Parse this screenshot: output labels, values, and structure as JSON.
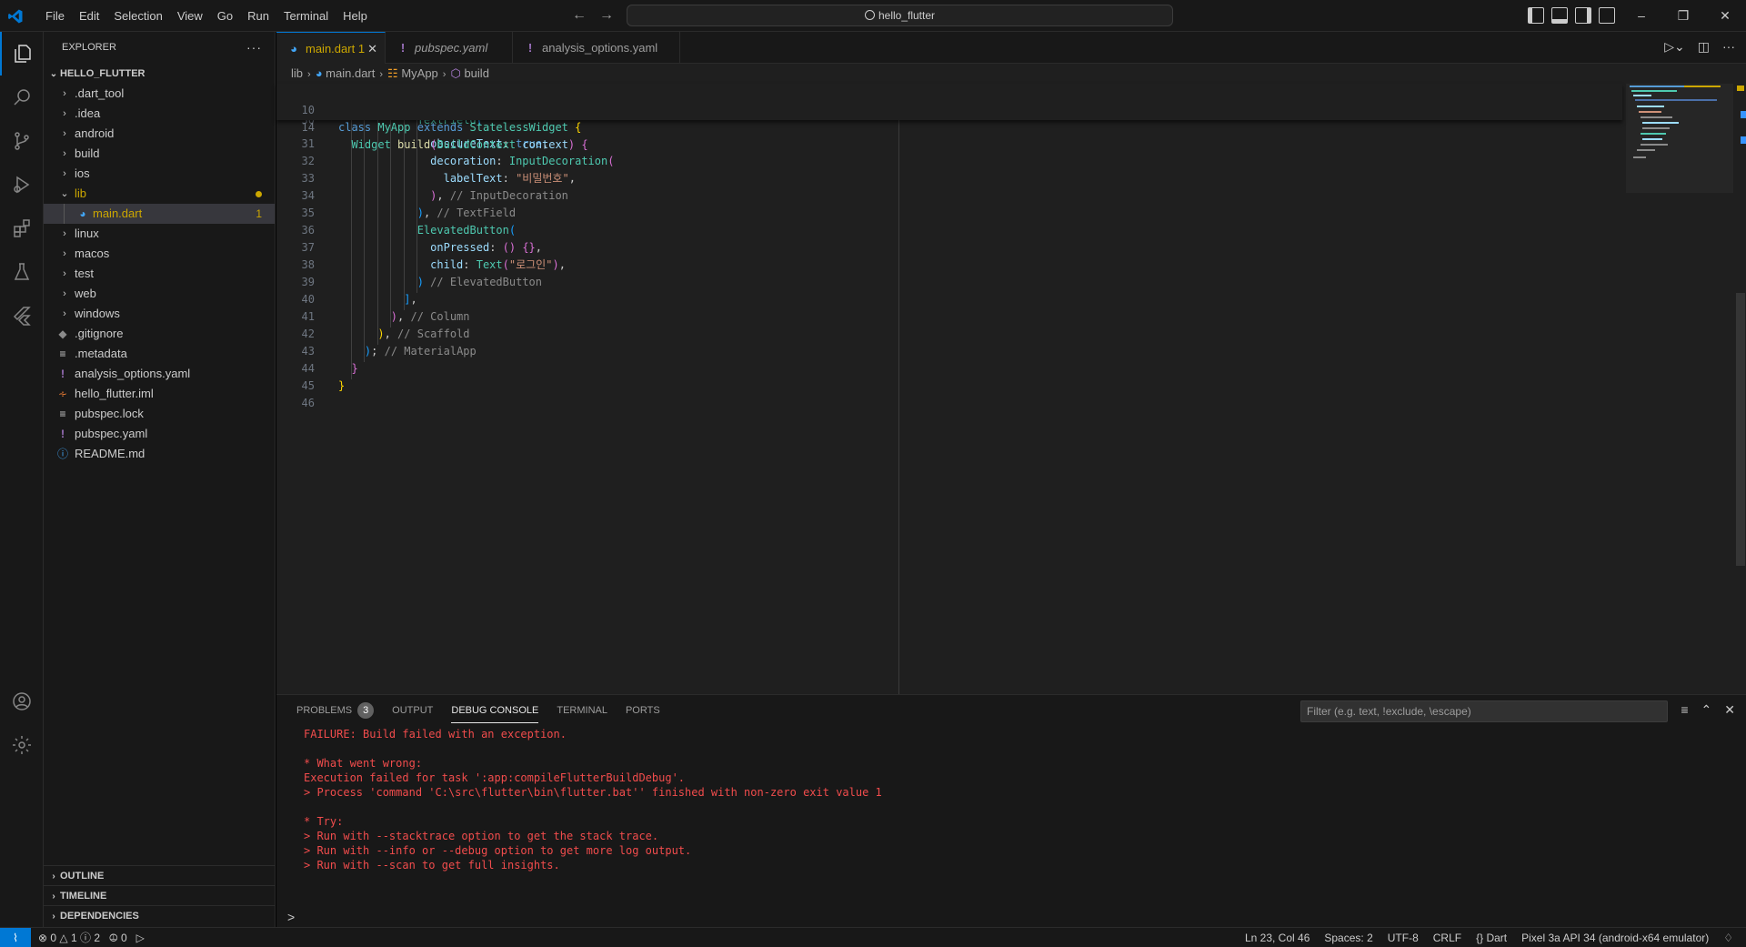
{
  "titlebar": {
    "menu": [
      "File",
      "Edit",
      "Selection",
      "View",
      "Go",
      "Run",
      "Terminal",
      "Help"
    ],
    "search": "hello_flutter"
  },
  "sidebar": {
    "header": "EXPLORER",
    "more": "···",
    "project": "HELLO_FLUTTER",
    "items": [
      {
        "label": "dart_tool",
        "prefix": "."
      },
      {
        "label": "idea",
        "prefix": "."
      },
      {
        "label": "android",
        "prefix": ""
      },
      {
        "label": "build",
        "prefix": ""
      },
      {
        "label": "ios",
        "prefix": ""
      },
      {
        "label": "lib",
        "prefix": ""
      },
      {
        "label": "main.dart",
        "prefix": ""
      },
      {
        "label": "linux",
        "prefix": ""
      },
      {
        "label": "macos",
        "prefix": ""
      },
      {
        "label": "test",
        "prefix": ""
      },
      {
        "label": "web",
        "prefix": ""
      },
      {
        "label": "windows",
        "prefix": ""
      },
      {
        "label": ".gitignore",
        "prefix": ""
      },
      {
        "label": ".metadata",
        "prefix": ""
      },
      {
        "label": "analysis_options.yaml",
        "prefix": ""
      },
      {
        "label": "hello_flutter.iml",
        "prefix": ""
      },
      {
        "label": "pubspec.lock",
        "prefix": ""
      },
      {
        "label": "pubspec.yaml",
        "prefix": ""
      },
      {
        "label": "README.md",
        "prefix": ""
      }
    ],
    "labels": {
      "dart_tool": ".dart_tool",
      "idea": ".idea",
      "main_badge": "1"
    },
    "bottom_sections": [
      "OUTLINE",
      "TIMELINE",
      "DEPENDENCIES"
    ]
  },
  "tabs": [
    {
      "label": "main.dart",
      "badge": "1"
    },
    {
      "label": "pubspec.yaml",
      "badge": ""
    },
    {
      "label": "analysis_options.yaml",
      "badge": ""
    }
  ],
  "breadcrumbs": [
    "lib",
    "main.dart",
    "MyApp",
    "build"
  ],
  "sticky": [
    {
      "n": "10",
      "text": "class MyApp extends StatelessWidget {"
    },
    {
      "n": "14",
      "text": "  Widget build(BuildContext context) {"
    }
  ],
  "code_lines": [
    {
      "n": "31",
      "text": "              obscureText: true,"
    },
    {
      "n": "32",
      "text": "              decoration: InputDecoration("
    },
    {
      "n": "33",
      "text": "                labelText: \"비밀번호\","
    },
    {
      "n": "34",
      "text": "              ), // InputDecoration"
    },
    {
      "n": "35",
      "text": "            ), // TextField"
    },
    {
      "n": "36",
      "text": "            ElevatedButton("
    },
    {
      "n": "37",
      "text": "              onPressed: () {},"
    },
    {
      "n": "38",
      "text": "              child: Text(\"로그인\"),"
    },
    {
      "n": "39",
      "text": "            ) // ElevatedButton"
    },
    {
      "n": "40",
      "text": "          ],"
    },
    {
      "n": "41",
      "text": "        ), // Column"
    },
    {
      "n": "42",
      "text": "      ), // Scaffold"
    },
    {
      "n": "43",
      "text": "    ); // MaterialApp"
    },
    {
      "n": "44",
      "text": "  }"
    },
    {
      "n": "45",
      "text": "}"
    },
    {
      "n": "46",
      "text": ""
    }
  ],
  "panel": {
    "tabs": [
      {
        "label": "PROBLEMS",
        "count": "3"
      },
      {
        "label": "OUTPUT",
        "count": ""
      },
      {
        "label": "DEBUG CONSOLE",
        "count": ""
      },
      {
        "label": "TERMINAL",
        "count": ""
      },
      {
        "label": "PORTS",
        "count": ""
      }
    ],
    "filter_placeholder": "Filter (e.g. text, !exclude, \\escape)",
    "console_lines": [
      "FAILURE: Build failed with an exception.",
      "",
      "* What went wrong:",
      "Execution failed for task ':app:compileFlutterBuildDebug'.",
      "> Process 'command 'C:\\src\\flutter\\bin\\flutter.bat'' finished with non-zero exit value 1",
      "",
      "* Try:",
      "> Run with --stacktrace option to get the stack trace.",
      "> Run with --info or --debug option to get more log output.",
      "> Run with --scan to get full insights."
    ],
    "prompt": ">"
  },
  "statusbar": {
    "errors": "0",
    "warnings": "1",
    "infos": "2",
    "ports": "0",
    "position": "Ln 23, Col 46",
    "spaces": "Spaces: 2",
    "encoding": "UTF-8",
    "eol": "CRLF",
    "language": "Dart",
    "device": "Pixel 3a API 34 (android-x64 emulator)"
  },
  "colors": {
    "accent": "#0078d4",
    "error": "#f14c4c",
    "modified": "#cca700",
    "dart": "#42a5f5",
    "yaml": "#a074c4"
  }
}
